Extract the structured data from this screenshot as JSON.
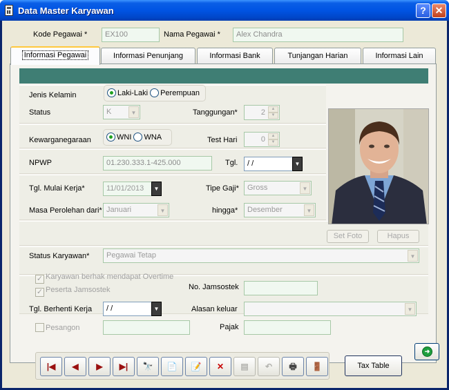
{
  "window": {
    "title": "Data Master Karyawan",
    "help_label": "?",
    "close_label": "✕"
  },
  "header": {
    "kode_label": "Kode Pegawai *",
    "kode_value": "EX100",
    "nama_label": "Nama Pegawai *",
    "nama_value": "Alex Chandra"
  },
  "tabs": [
    {
      "label": "Informasi Pegawai"
    },
    {
      "label": "Informasi Penunjang"
    },
    {
      "label": "Informasi Bank"
    },
    {
      "label": "Tunjangan Harian"
    },
    {
      "label": "Informasi Lain"
    }
  ],
  "form": {
    "jenis_kelamin_label": "Jenis Kelamin",
    "gender_options": [
      "Laki-Laki",
      "Perempuan"
    ],
    "gender_selected": "Laki-Laki",
    "status_label": "Status",
    "status_value": "K",
    "tanggungan_label": "Tanggungan*",
    "tanggungan_value": "2",
    "kewarganegaraan_label": "Kewarganegaraan",
    "citizen_options": [
      "WNI",
      "WNA"
    ],
    "citizen_selected": "WNI",
    "test_hari_label": "Test Hari",
    "test_hari_value": "0",
    "npwp_label": "NPWP",
    "npwp_value": "01.230.333.1-425.000",
    "tgl_label": "Tgl.",
    "tgl_value": " / /",
    "mulai_kerja_label": "Tgl. Mulai Kerja*",
    "mulai_kerja_value": "11/01/2013",
    "tipe_gaji_label": "Tipe Gaji*",
    "tipe_gaji_value": "Gross",
    "masa_label": "Masa Perolehan dari*",
    "masa_value": "Januari",
    "hingga_label": "hingga*",
    "hingga_value": "Desember",
    "status_karyawan_label": "Status Karyawan*",
    "status_karyawan_value": "Pegawai Tetap",
    "overtime_label": "Karyawan berhak mendapat Overtime",
    "jamsostek_peserta_label": "Peserta Jamsostek",
    "no_jamsostek_label": "No. Jamsostek",
    "no_jamsostek_value": "",
    "berhenti_label": "Tgl. Berhenti Kerja",
    "berhenti_value": " / /",
    "alasan_label": "Alasan keluar",
    "alasan_value": "",
    "pesangon_label": "Pesangon",
    "pesangon_value": "",
    "pajak_label": "Pajak",
    "pajak_value": ""
  },
  "photo": {
    "set_label": "Set Foto",
    "hapus_label": "Hapus"
  },
  "navigation": {
    "first_icon": "first-record-icon",
    "prev_icon": "previous-record-icon",
    "next_icon": "next-record-icon",
    "last_icon": "last-record-icon",
    "tax_table_label": "Tax Table"
  },
  "colors": {
    "teal_bar": "#3f7e74",
    "title_blue": "#0054e3",
    "panel_bg": "#ece9d8"
  }
}
